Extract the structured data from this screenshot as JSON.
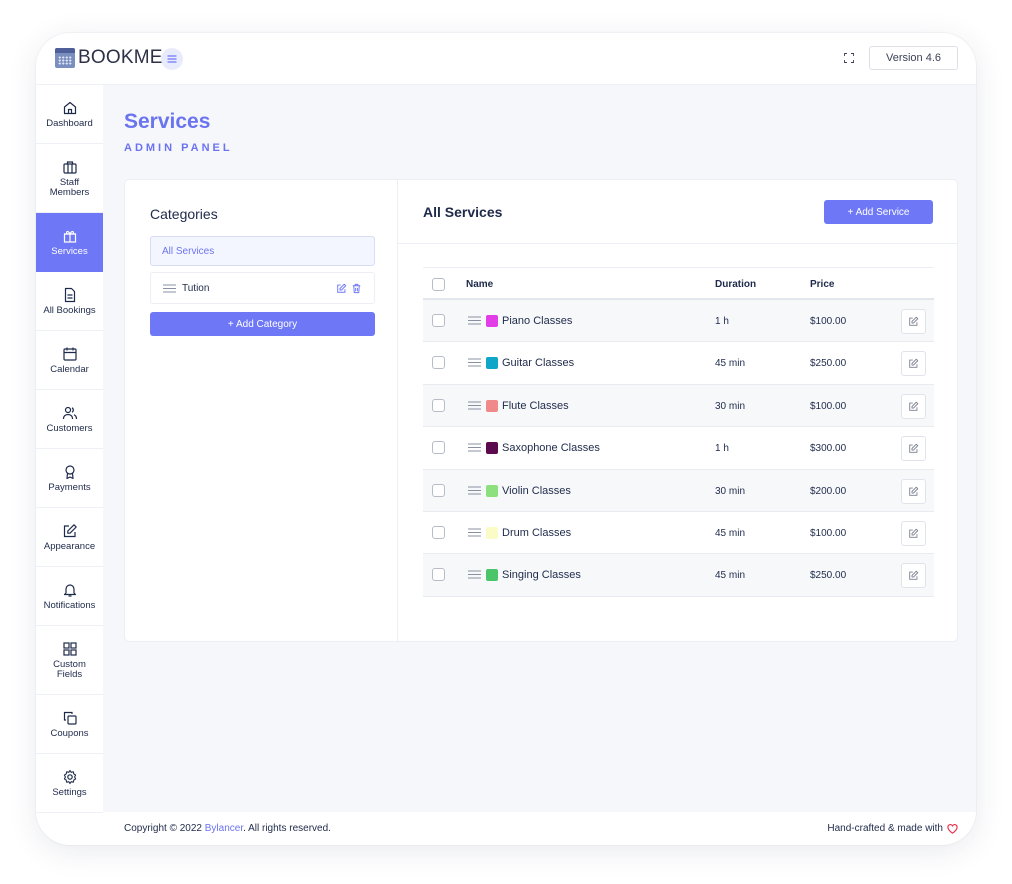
{
  "header": {
    "app_name": "BOOKME",
    "version_label": "Version 4.6"
  },
  "sidebar": {
    "items": [
      {
        "label": "Dashboard",
        "icon": "home-icon"
      },
      {
        "label": "Staff Members",
        "icon": "briefcase-icon"
      },
      {
        "label": "Services",
        "icon": "gift-icon",
        "active": true
      },
      {
        "label": "All Bookings",
        "icon": "document-icon"
      },
      {
        "label": "Calendar",
        "icon": "calendar-icon"
      },
      {
        "label": "Customers",
        "icon": "users-icon"
      },
      {
        "label": "Payments",
        "icon": "award-icon"
      },
      {
        "label": "Appearance",
        "icon": "edit-icon"
      },
      {
        "label": "Notifications",
        "icon": "bell-icon"
      },
      {
        "label": "Custom Fields",
        "icon": "grid-icon"
      },
      {
        "label": "Coupons",
        "icon": "copy-icon"
      },
      {
        "label": "Settings",
        "icon": "gear-icon"
      }
    ]
  },
  "page": {
    "title": "Services",
    "subtitle": "ADMIN PANEL"
  },
  "categories": {
    "title": "Categories",
    "all_label": "All Services",
    "items": [
      {
        "label": "Tution"
      }
    ],
    "add_label": "+ Add Category"
  },
  "services": {
    "title": "All Services",
    "add_label": "+ Add Service",
    "columns": {
      "name": "Name",
      "duration": "Duration",
      "price": "Price"
    },
    "rows": [
      {
        "name": "Piano Classes",
        "duration": "1 h",
        "price": "$100.00",
        "color": "#e23ee8"
      },
      {
        "name": "Guitar Classes",
        "duration": "45 min",
        "price": "$250.00",
        "color": "#10a6c7"
      },
      {
        "name": "Flute Classes",
        "duration": "30 min",
        "price": "$100.00",
        "color": "#f08a8a"
      },
      {
        "name": "Saxophone Classes",
        "duration": "1 h",
        "price": "$300.00",
        "color": "#5c0a4e"
      },
      {
        "name": "Violin Classes",
        "duration": "30 min",
        "price": "$200.00",
        "color": "#8ee07e"
      },
      {
        "name": "Drum Classes",
        "duration": "45 min",
        "price": "$100.00",
        "color": "#fbfbc8"
      },
      {
        "name": "Singing Classes",
        "duration": "45 min",
        "price": "$250.00",
        "color": "#4cc46a"
      }
    ]
  },
  "footer": {
    "copyright_prefix": "Copyright © 2022 ",
    "brand": "Bylancer",
    "copyright_suffix": ". All rights reserved.",
    "credit": "Hand-crafted & made with"
  },
  "colors": {
    "accent": "#6e78f7",
    "heart": "#e8344e"
  }
}
